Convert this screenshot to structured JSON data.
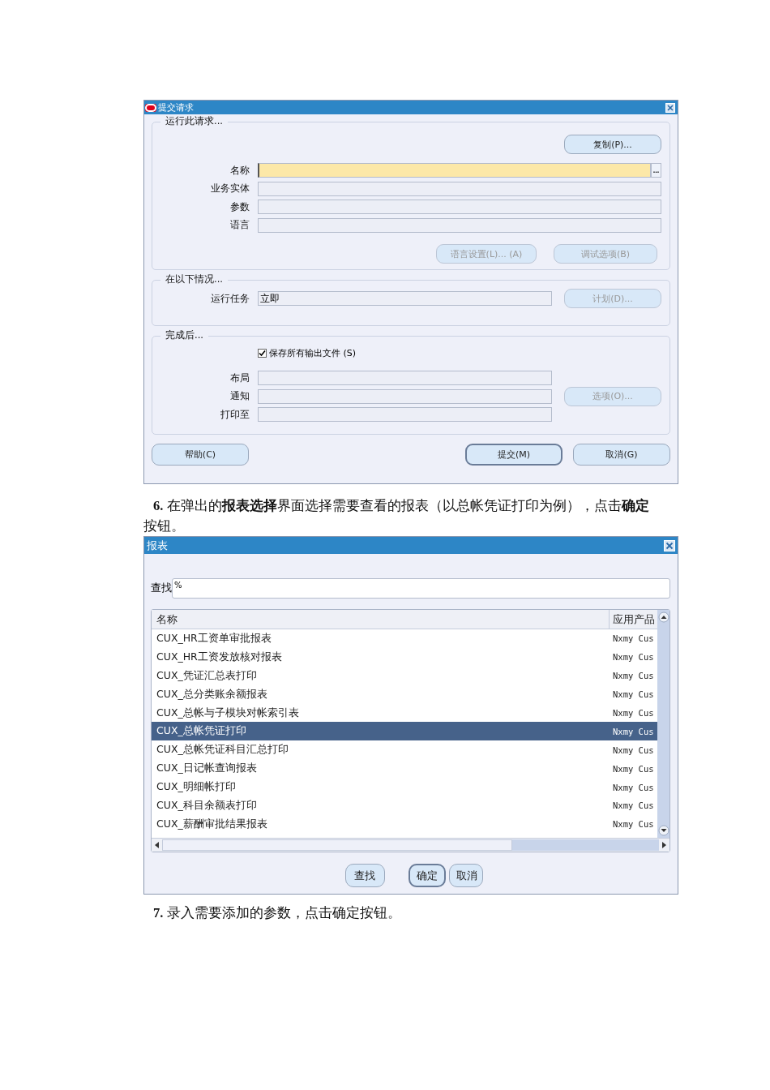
{
  "submit_dialog": {
    "title": "提交请求",
    "sections": [
      {
        "legend": "运行此请求...",
        "kind": "request",
        "top_button": {
          "label": "复制(P)...",
          "disabled": false
        },
        "fields": [
          {
            "label": "名称",
            "focused": true,
            "lov_button": "..."
          },
          {
            "label": "业务实体",
            "focused": false
          },
          {
            "label": "参数",
            "focused": false
          },
          {
            "label": "语言",
            "focused": false
          }
        ],
        "buttons": [
          {
            "label": "语言设置(L)... (A)",
            "disabled": true
          },
          {
            "label": "调试选项(B)",
            "disabled": true
          }
        ]
      },
      {
        "legend": "在以下情况...",
        "kind": "schedule",
        "fields": [
          {
            "label": "运行任务",
            "value": "立即",
            "focused": false
          }
        ],
        "side_button": {
          "label": "计划(D)...",
          "disabled": true
        }
      },
      {
        "legend": "完成后...",
        "kind": "completion",
        "checkbox": {
          "label": "保存所有输出文件 (S)",
          "checked": true
        },
        "fields": [
          {
            "label": "布局",
            "focused": false
          },
          {
            "label": "通知",
            "focused": false
          },
          {
            "label": "打印至",
            "focused": false
          }
        ],
        "side_button": {
          "label": "选项(O)...",
          "disabled": true
        }
      }
    ],
    "buttons": [
      {
        "label": "帮助(C)",
        "default": false
      },
      {
        "label": "提交(M)",
        "default": true
      },
      {
        "label": "取消(G)",
        "default": false
      }
    ]
  },
  "step_6": "**6.** 在弹出的**报表选择**界面选择需要查看的报表（以总帐凭证打印为例），点击**确定**按钮。",
  "report_dialog": {
    "title": "报表",
    "search": {
      "label": "查找",
      "value": "%"
    },
    "table": {
      "columns": [
        "名称",
        "应用产品"
      ],
      "rows": [
        {
          "name": "CUX_HR工资单审批报表",
          "product": "Nxmy Cus",
          "selected": false
        },
        {
          "name": "CUX_HR工资发放核对报表",
          "product": "Nxmy Cus",
          "selected": false
        },
        {
          "name": "CUX_凭证汇总表打印",
          "product": "Nxmy Cus",
          "selected": false
        },
        {
          "name": "CUX_总分类账余额报表",
          "product": "Nxmy Cus",
          "selected": false
        },
        {
          "name": "CUX_总帐与子模块对帐索引表",
          "product": "Nxmy Cus",
          "selected": false
        },
        {
          "name": "CUX_总帐凭证打印",
          "product": "Nxmy Cus",
          "selected": true
        },
        {
          "name": "CUX_总帐凭证科目汇总打印",
          "product": "Nxmy Cus",
          "selected": false
        },
        {
          "name": "CUX_日记帐查询报表",
          "product": "Nxmy Cus",
          "selected": false
        },
        {
          "name": "CUX_明细帐打印",
          "product": "Nxmy Cus",
          "selected": false
        },
        {
          "name": "CUX_科目余额表打印",
          "product": "Nxmy Cus",
          "selected": false
        },
        {
          "name": "CUX_薪酬审批结果报表",
          "product": "Nxmy Cus",
          "selected": false
        }
      ]
    },
    "buttons": [
      {
        "label": "查找",
        "default": false
      },
      {
        "label": "确定",
        "default": true
      },
      {
        "label": "取消",
        "default": false
      }
    ]
  },
  "step_7": "**7.** 录入需要添加的参数，点击确定按钮。"
}
